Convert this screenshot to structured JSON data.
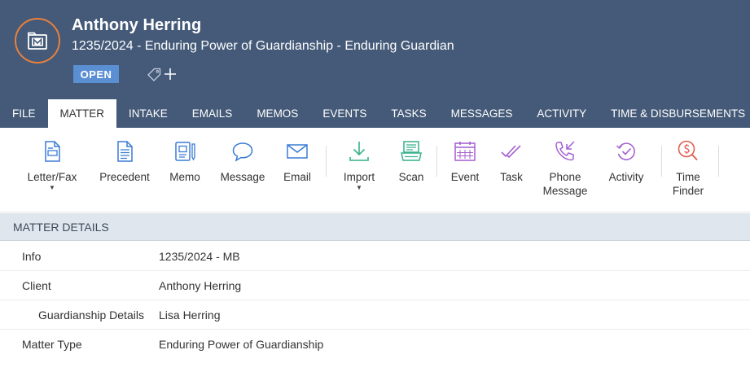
{
  "header": {
    "client_name": "Anthony Herring",
    "matter_subtitle": "1235/2024 - Enduring Power of Guardianship - Enduring Guardian",
    "status": "OPEN",
    "colors": {
      "header_bg": "#445a78",
      "logo_ring": "#e8803e",
      "badge": "#5b8fd4"
    }
  },
  "tabs": [
    {
      "label": "FILE",
      "active": false
    },
    {
      "label": "MATTER",
      "active": true
    },
    {
      "label": "INTAKE",
      "active": false
    },
    {
      "label": "EMAILS",
      "active": false
    },
    {
      "label": "MEMOS",
      "active": false
    },
    {
      "label": "EVENTS",
      "active": false
    },
    {
      "label": "TASKS",
      "active": false
    },
    {
      "label": "MESSAGES",
      "active": false
    },
    {
      "label": "ACTIVITY",
      "active": false
    },
    {
      "label": "TIME & DISBURSEMENTS",
      "active": false
    }
  ],
  "toolbar": {
    "letter_fax": {
      "label": "Letter/Fax",
      "icon": "letter-icon"
    },
    "precedent": {
      "label": "Precedent",
      "icon": "document-icon"
    },
    "memo": {
      "label": "Memo",
      "icon": "memo-icon"
    },
    "message": {
      "label": "Message",
      "icon": "speech-bubble-icon"
    },
    "email": {
      "label": "Email",
      "icon": "envelope-icon"
    },
    "import": {
      "label": "Import",
      "icon": "download-icon"
    },
    "scan": {
      "label": "Scan",
      "icon": "scanner-icon"
    },
    "event": {
      "label": "Event",
      "icon": "calendar-icon"
    },
    "task": {
      "label": "Task",
      "icon": "double-check-icon"
    },
    "phone_message": {
      "line1": "Phone",
      "line2": "Message",
      "icon": "phone-callback-icon"
    },
    "activity": {
      "label": "Activity",
      "icon": "history-check-icon"
    },
    "time_finder": {
      "line1": "Time",
      "line2": "Finder",
      "icon": "dollar-search-icon"
    }
  },
  "matter_details": {
    "title": "MATTER DETAILS",
    "rows": [
      {
        "label": "Info",
        "value": "1235/2024 - MB"
      },
      {
        "label": "Client",
        "value": "Anthony Herring"
      },
      {
        "label": "Guardianship Details",
        "value": "Lisa Herring"
      },
      {
        "label": "Matter Type",
        "value": "Enduring Power of Guardianship"
      }
    ]
  }
}
